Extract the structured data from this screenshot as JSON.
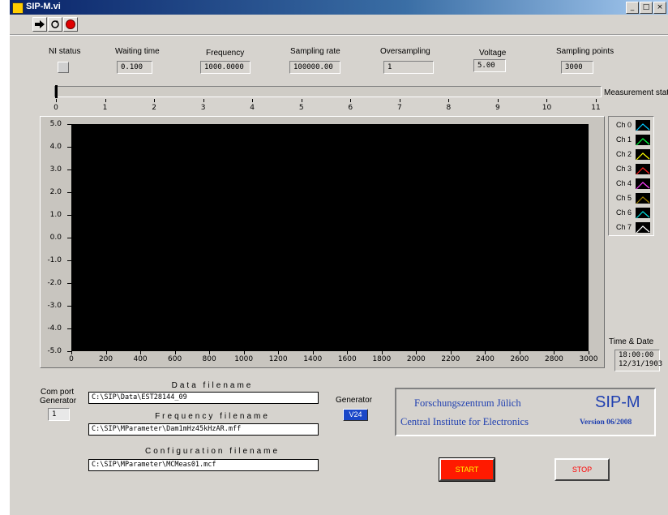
{
  "window": {
    "title": "SIP-M.vi",
    "controls": [
      "_",
      "□",
      "×"
    ]
  },
  "toolbar": {
    "icons": [
      "run-arrow-icon",
      "run-continuous-icon",
      "abort-icon"
    ]
  },
  "top_controls": {
    "ni_status_label": "NI status",
    "waiting_time_label": "Waiting time",
    "waiting_time": "0.100",
    "frequency_label": "Frequency",
    "frequency": "1000.0000",
    "sampling_rate_label": "Sampling rate",
    "sampling_rate": "100000.00",
    "oversampling_label": "Oversampling",
    "oversampling": "1",
    "voltage_label": "Voltage",
    "voltage": "5.00",
    "sampling_points_label": "Sampling points",
    "sampling_points": "3000"
  },
  "measurement_status": {
    "label": "Measurement status",
    "scale": [
      "0",
      "1",
      "2",
      "3",
      "4",
      "5",
      "6",
      "7",
      "8",
      "9",
      "10",
      "11"
    ],
    "value": 0
  },
  "chart_data": {
    "type": "line",
    "title": "",
    "xlabel": "",
    "ylabel": "",
    "xlim": [
      0,
      3000
    ],
    "ylim": [
      -5.0,
      5.0
    ],
    "x_ticks": [
      "0",
      "200",
      "400",
      "600",
      "800",
      "1000",
      "1200",
      "1400",
      "1600",
      "1800",
      "2000",
      "2200",
      "2400",
      "2600",
      "2800",
      "3000"
    ],
    "y_ticks": [
      "5.0",
      "4.0",
      "3.0",
      "2.0",
      "1.0",
      "0.0",
      "-1.0",
      "-2.0",
      "-3.0",
      "-4.0",
      "-5.0"
    ],
    "series": [
      {
        "name": "Ch 0",
        "color": "#00c8ff",
        "values": []
      },
      {
        "name": "Ch 1",
        "color": "#00ff40",
        "values": []
      },
      {
        "name": "Ch 2",
        "color": "#ffff00",
        "values": []
      },
      {
        "name": "Ch 3",
        "color": "#ff2020",
        "values": []
      },
      {
        "name": "Ch 4",
        "color": "#ff40ff",
        "values": []
      },
      {
        "name": "Ch 5",
        "color": "#a08000",
        "values": []
      },
      {
        "name": "Ch 6",
        "color": "#00e0e0",
        "values": []
      },
      {
        "name": "Ch 7",
        "color": "#ffffff",
        "values": []
      }
    ],
    "grid": false,
    "legend": "right"
  },
  "time_date": {
    "label": "Time & Date",
    "time": "18:00:00",
    "date": "12/31/1903"
  },
  "com_port": {
    "label_line1": "Com port",
    "label_line2": "Generator",
    "value": "1"
  },
  "files": {
    "data_label": "Data filename",
    "data_value": "C:\\SIP\\Data\\EST28144_09",
    "frequency_label": "Frequency filename",
    "frequency_value": "C:\\SIP\\MParameter\\Dam1mHz45kHzAR.mff",
    "configuration_label": "Configuration filename",
    "configuration_value": "C:\\SIP\\MParameter\\MCMeas01.mcf"
  },
  "generator": {
    "label": "Generator",
    "value": "V24"
  },
  "brand": {
    "institution": "Forschungszentrum Jülich",
    "product": "SIP-M",
    "department": "Central Institute for Electronics",
    "version": "Version 06/2008"
  },
  "buttons": {
    "start": "START",
    "stop": "STOP"
  },
  "colors": {
    "start_bg": "#ff1a00",
    "start_text": "#ffff00",
    "stop_text": "#ff0000",
    "brand_blue": "#1f3fb0"
  }
}
